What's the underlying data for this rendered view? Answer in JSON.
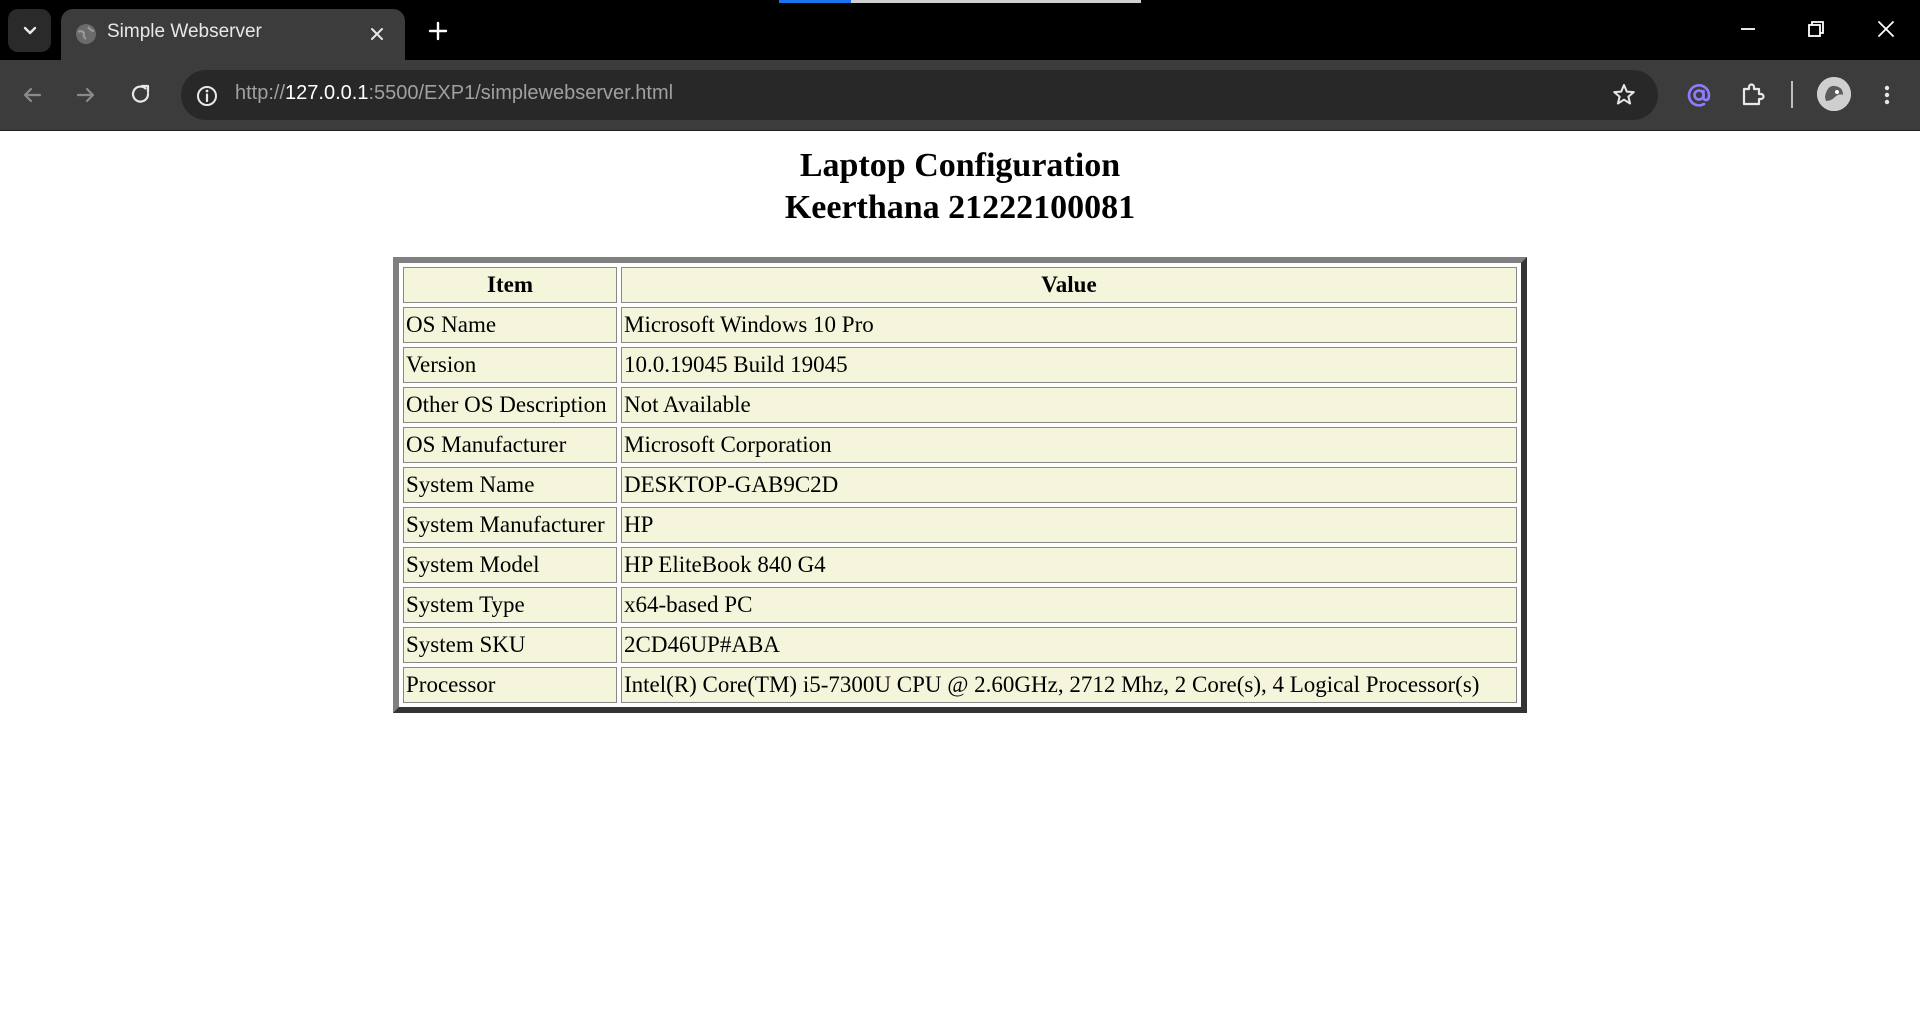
{
  "browser": {
    "tab": {
      "title": "Simple Webserver"
    },
    "url": {
      "scheme": "http://",
      "host": "127.0.0.1",
      "rest": ":5500/EXP1/simplewebserver.html"
    }
  },
  "page": {
    "title_line1": "Laptop Configuration",
    "title_line2": "Keerthana 21222100081",
    "table": {
      "headers": {
        "item": "Item",
        "value": "Value"
      },
      "rows": [
        {
          "item": "OS Name",
          "value": "Microsoft Windows 10 Pro"
        },
        {
          "item": "Version",
          "value": "10.0.19045 Build 19045"
        },
        {
          "item": "Other OS Description",
          "value": "Not Available"
        },
        {
          "item": "OS Manufacturer",
          "value": "Microsoft Corporation"
        },
        {
          "item": "System Name",
          "value": "DESKTOP-GAB9C2D"
        },
        {
          "item": "System Manufacturer",
          "value": "HP"
        },
        {
          "item": "System Model",
          "value": "HP EliteBook 840 G4"
        },
        {
          "item": "System Type",
          "value": "x64-based PC"
        },
        {
          "item": "System SKU",
          "value": "2CD46UP#ABA"
        },
        {
          "item": "Processor",
          "value": "Intel(R) Core(TM) i5-7300U CPU @ 2.60GHz, 2712 Mhz, 2 Core(s), 4 Logical Processor(s)"
        }
      ]
    }
  },
  "colors": {
    "table_cell_bg": "#f5f5dc",
    "accent": "#1a73e8",
    "extension_accent": "#8e7cff"
  },
  "icons": {
    "tab_search": "chevron-down-icon",
    "favicon": "globe-icon",
    "close": "close-icon",
    "new_tab": "plus-icon",
    "back": "arrow-left-icon",
    "forward": "arrow-right-icon",
    "reload": "reload-icon",
    "site_info": "info-icon",
    "bookmark": "star-icon",
    "extension_at": "at-sign-icon",
    "extensions": "puzzle-icon",
    "profile": "avatar",
    "menu": "kebab-menu-icon"
  }
}
